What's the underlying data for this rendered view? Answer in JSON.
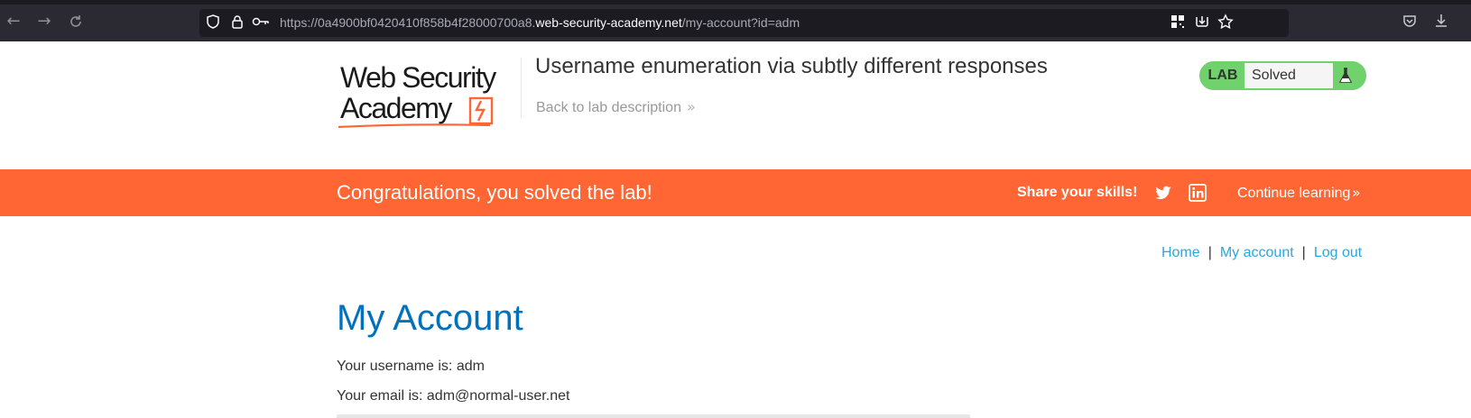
{
  "browser": {
    "url_prefix": "https://0a4900bf0420410f858b4f28000700a8.",
    "url_host": "web-security-academy.net",
    "url_path": "/my-account?id=adm"
  },
  "header": {
    "logo_line1": "Web Security",
    "logo_line2": "Academy",
    "lab_title": "Username enumeration via subtly different responses",
    "back_link": "Back to lab description",
    "lab_tag": "LAB",
    "lab_status": "Solved"
  },
  "banner": {
    "message": "Congratulations, you solved the lab!",
    "share": "Share your skills!",
    "continue": "Continue learning",
    "color": "#ff6633"
  },
  "nav": {
    "home": "Home",
    "separator": "|",
    "my_account": "My account",
    "logout": "Log out"
  },
  "main": {
    "title": "My Account",
    "username_line": "Your username is: adm",
    "email_line": "Your email is: adm@normal-user.net"
  },
  "colors": {
    "accent_orange": "#ff6633",
    "link_blue": "#29a8e0",
    "title_blue": "#0071bc",
    "solved_green": "#70d16d"
  },
  "icons": [
    "back-icon",
    "forward-icon",
    "reload-icon",
    "shield-icon",
    "lock-icon",
    "key-icon",
    "qr-icon",
    "pocket-save-icon",
    "star-icon",
    "pocket-icon",
    "download-icon",
    "flask-icon",
    "twitter-icon",
    "linkedin-icon"
  ]
}
